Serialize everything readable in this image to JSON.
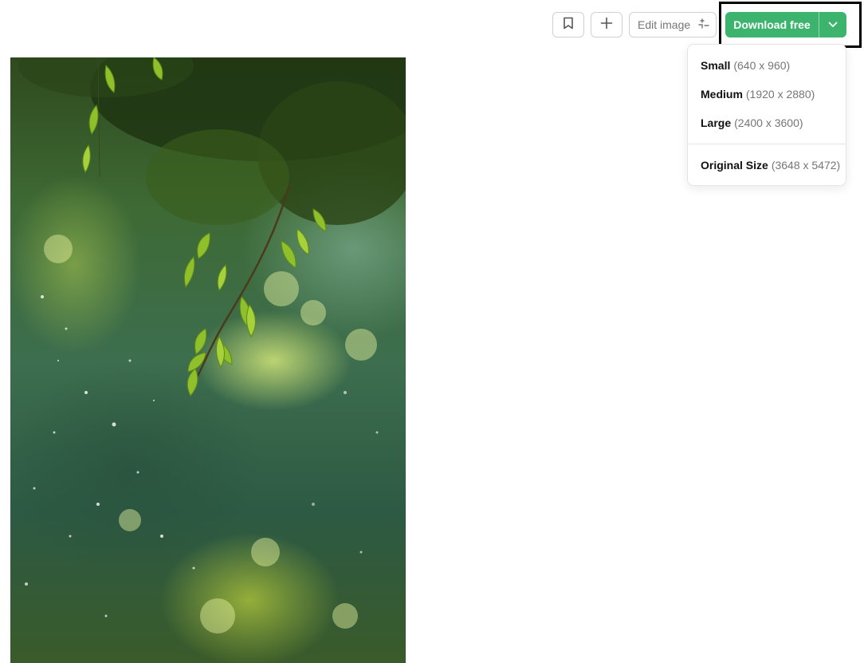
{
  "toolbar": {
    "bookmark_icon": "bookmark-icon",
    "collect_icon": "plus-icon",
    "edit_label": "Edit image",
    "edit_icon": "magic-sparkle-icon",
    "download_label": "Download free",
    "download_chevron_icon": "chevron-down-icon",
    "accent_color": "#3cb46e"
  },
  "download_menu": {
    "items": [
      {
        "name": "Small",
        "dims": "(640 x 960)"
      },
      {
        "name": "Medium",
        "dims": "(1920 x 2880)"
      },
      {
        "name": "Large",
        "dims": "(2400 x 3600)"
      },
      {
        "name": "Original Size",
        "dims": "(3648 x 5472)"
      }
    ]
  },
  "photo": {
    "subject": "green-leaves-bokeh-photo"
  }
}
